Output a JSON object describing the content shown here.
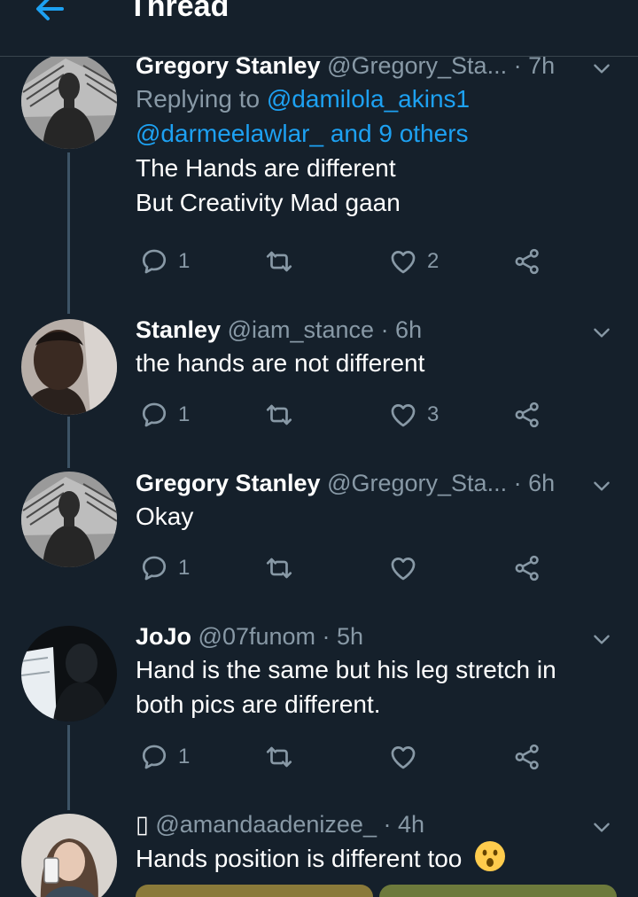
{
  "header": {
    "title": "Thread"
  },
  "tweets": [
    {
      "name": "Gregory Stanley",
      "handle": "@Gregory_Sta...",
      "time": "· 7h",
      "replying_prefix": "Replying to ",
      "replying_mention1": "@damilola_akins1",
      "replying_mention2": "@darmeelawlar_ and 9 others",
      "text1": "The Hands are different",
      "text2": "But Creativity Mad gaan",
      "reply_count": "1",
      "retweet_count": "",
      "like_count": "2"
    },
    {
      "name": "Stanley",
      "handle": "@iam_stance",
      "time": "· 6h",
      "text1": "the hands are not different",
      "reply_count": "1",
      "retweet_count": "",
      "like_count": "3"
    },
    {
      "name": "Gregory Stanley",
      "handle": "@Gregory_Sta...",
      "time": "· 6h",
      "text1": "Okay",
      "reply_count": "1",
      "retweet_count": "",
      "like_count": ""
    },
    {
      "name": "JoJo",
      "handle": "@07funom",
      "time": "· 5h",
      "text1": "Hand is the same but his leg stretch in",
      "text2": "both pics are different.",
      "reply_count": "1",
      "retweet_count": "",
      "like_count": ""
    },
    {
      "name": "▯",
      "handle": "@amandaadenizee_",
      "time": "· 4h",
      "text1": "Hands position is different too",
      "emoji": "hushed-face-emoji"
    }
  ],
  "icons": {
    "back": "arrow-left-icon",
    "caret": "chevron-down-icon",
    "reply": "comment-icon",
    "retweet": "retweet-icon",
    "like": "heart-icon",
    "share": "share-icon"
  },
  "colors": {
    "background": "#15202b",
    "accent": "#1da1f2",
    "muted": "#8899a6",
    "divider": "#38444d",
    "thread_line": "#3d5466"
  }
}
